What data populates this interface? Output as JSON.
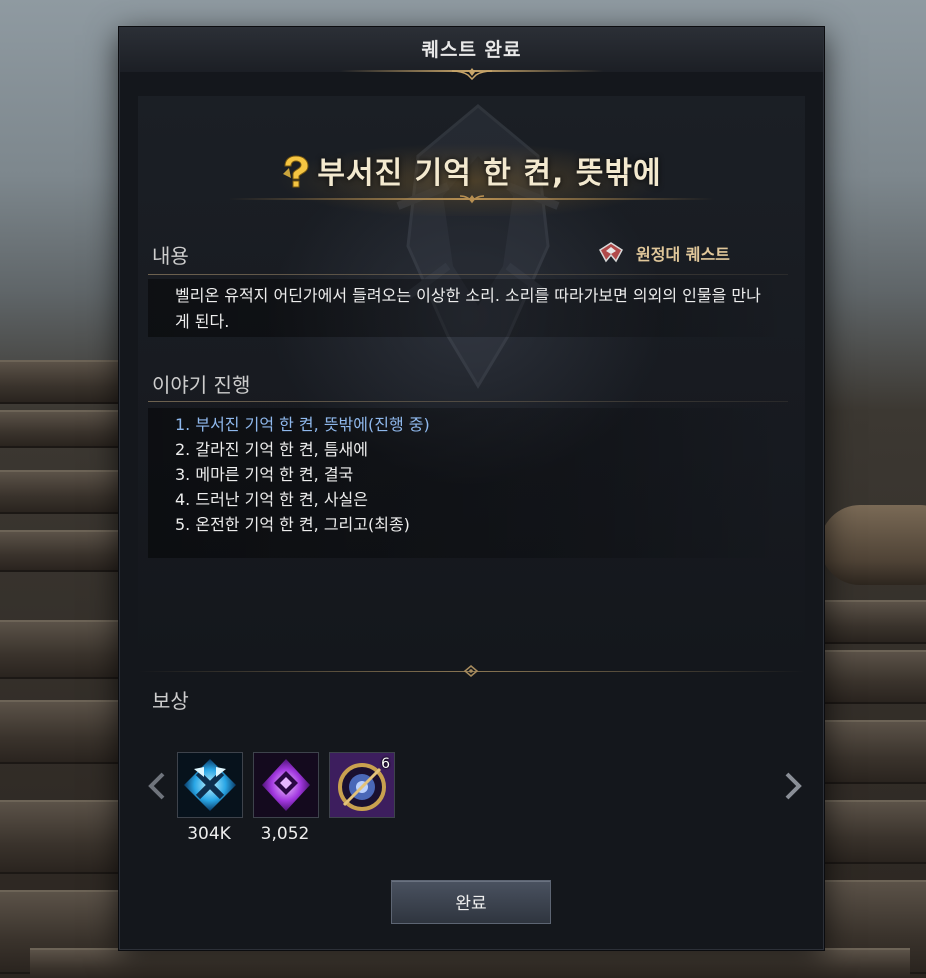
{
  "window": {
    "title": "퀘스트 완료"
  },
  "quest": {
    "title": "부서진 기억 한 켠, 뜻밖에",
    "icon": "quest-marker-icon",
    "type_label": "원정대 퀘스트",
    "type_icon": "expedition-emblem-icon"
  },
  "content_section": {
    "label": "내용",
    "description": "벨리온 유적지 어딘가에서 들려오는 이상한 소리. 소리를 따라가보면 의외의 인물을 만나게 된다."
  },
  "story_section": {
    "label": "이야기 진행",
    "steps": [
      {
        "text": "1. 부서진 기억 한 켠, 뜻밖에(진행 중)",
        "active": true
      },
      {
        "text": "2. 갈라진 기억 한 켠, 틈새에",
        "active": false
      },
      {
        "text": "3. 메마른 기억 한 켠, 결국",
        "active": false
      },
      {
        "text": "4. 드러난 기억 한 켠, 사실은",
        "active": false
      },
      {
        "text": "5. 온전한 기억 한 켠, 그리고(최종)",
        "active": false
      }
    ]
  },
  "rewards": {
    "label": "보상",
    "items": [
      {
        "icon": "blue-crossed-hammers-icon",
        "quantity": "304K"
      },
      {
        "icon": "purple-crystal-icon",
        "quantity": "3,052"
      },
      {
        "icon": "compass-orb-icon",
        "stack": "6"
      }
    ]
  },
  "buttons": {
    "complete": "완료"
  },
  "colors": {
    "active_step": "#8fb8ec",
    "quest_type": "#e0c79a",
    "gold_accent": "#c9a66a"
  }
}
